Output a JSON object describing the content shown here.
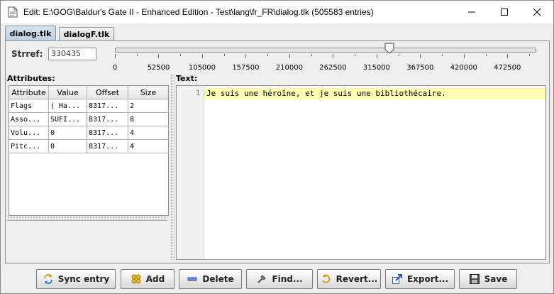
{
  "window": {
    "title": "Edit: E:\\GOG\\Baldur's Gate II - Enhanced Edition - Test\\lang\\fr_FR\\dialog.tlk (505583 entries)"
  },
  "tabs": [
    {
      "label": "dialog.tlk",
      "active": true
    },
    {
      "label": "dialogF.tlk",
      "active": false
    }
  ],
  "strref": {
    "label": "Strref:",
    "value": "330435"
  },
  "slider": {
    "value": 330435,
    "min": 0,
    "max": 505583,
    "tick_labels": [
      "0",
      "52500",
      "105000",
      "157500",
      "210000",
      "262500",
      "315000",
      "367500",
      "420000",
      "472500"
    ]
  },
  "attributes": {
    "title": "Attributes:",
    "columns": [
      "Attribute",
      "Value",
      "Offset",
      "Size"
    ],
    "rows": [
      [
        "Flags",
        "( Ha...",
        "8317...",
        "2"
      ],
      [
        "Asso...",
        "SUFI...",
        "8317...",
        "8"
      ],
      [
        "Volu...",
        "0",
        "8317...",
        "4"
      ],
      [
        "Pitc...",
        "0",
        "8317...",
        "4"
      ]
    ]
  },
  "text": {
    "title": "Text:",
    "line_number": "1",
    "content": "Je suis une héroïne, et je suis une bibliothécaire."
  },
  "buttons": {
    "sync": "Sync entry",
    "add": "Add",
    "delete": "Delete",
    "find": "Find...",
    "revert": "Revert...",
    "export": "Export...",
    "save": "Save"
  },
  "icons": [
    "document-icon",
    "minimize-icon",
    "maximize-icon",
    "close-icon",
    "sync-icon",
    "add-icon",
    "delete-icon",
    "find-icon",
    "revert-icon",
    "export-icon",
    "save-icon"
  ],
  "colors": {
    "current_line": "#fdfdb4",
    "active_tab": "#c6d8ea"
  }
}
